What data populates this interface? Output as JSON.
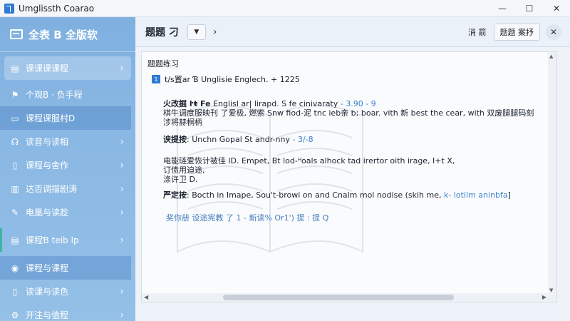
{
  "window": {
    "title": "Umglissth Coarao",
    "controls": [
      "—",
      "☐",
      "✕"
    ]
  },
  "sidebar": {
    "brand": "全表 B 全版软",
    "items": [
      {
        "label": "课课课课程",
        "icon": "book-icon"
      },
      {
        "label": "个观B · 负手程",
        "icon": "flag-icon"
      },
      {
        "label": "课程课服村D",
        "icon": "card-icon"
      },
      {
        "label": "读音与读相",
        "icon": "headset-icon"
      },
      {
        "label": "课程与舍作",
        "icon": "open-book-icon"
      },
      {
        "label": "达否调描剧涛",
        "icon": "chart-icon"
      },
      {
        "label": "电凰与读趁",
        "icon": "pen-icon"
      },
      {
        "label": "课程Ɓ teib Ip",
        "icon": "book-icon"
      },
      {
        "label": "课程与课程",
        "icon": "compass-icon"
      },
      {
        "label": "读课与读色",
        "icon": "open-book-icon"
      },
      {
        "label": "开注与值程",
        "icon": "gear-icon"
      }
    ]
  },
  "topbar": {
    "title": "题题 刁",
    "link": "消 箭",
    "chip": "题题 案抒"
  },
  "content": {
    "section_title": "题题练习",
    "question_number": "1",
    "question_text": "t/s置ar Ɓ Unglisie Englech. + 1225",
    "block1_bold": "火改掘 ŀŧ Fe",
    "block1_text": " Englisl ar| lirapd. S fe cinivaraty",
    "block1_hl": "- 3.90 - 9",
    "block1_line2": "棋牛调度服映刊 了爱极, 燃索 Snw fiod-泥 tnc ieb亲 b; boar. vith 新 best the cear, with 双废腿腿码刻",
    "block1_line3": "涉将赫桐柄",
    "block2_bold": "谀提按",
    "block2_text": ": Unchn Gopal St andr-nny",
    "block2_hl": "- 3/-8",
    "block3_line1": "电能琏爱恢计被佳 lD. Empet, Bt lod-ᴴoals alhock tad irertor oith irage, I+t X,",
    "block3_line2": "订债用迫途,",
    "block3_line3": "涤许卫 D.",
    "block4_bold": "严定按",
    "block4_text": ": Bocth in  Imape, Sou't-browi on and Cnalm mol nodise (skih me, ",
    "block4_hl": "k- lotilm aninbfa",
    "block4_end": "]",
    "footer": "奖你册 设途宪教 了 1 - 新读% Or1') 提 : 提 Q"
  },
  "colors": {
    "sidebar": "#8ab8e4",
    "accent": "#2f7ad2",
    "link": "#3c80d0",
    "marker": "#3bb5a6"
  }
}
